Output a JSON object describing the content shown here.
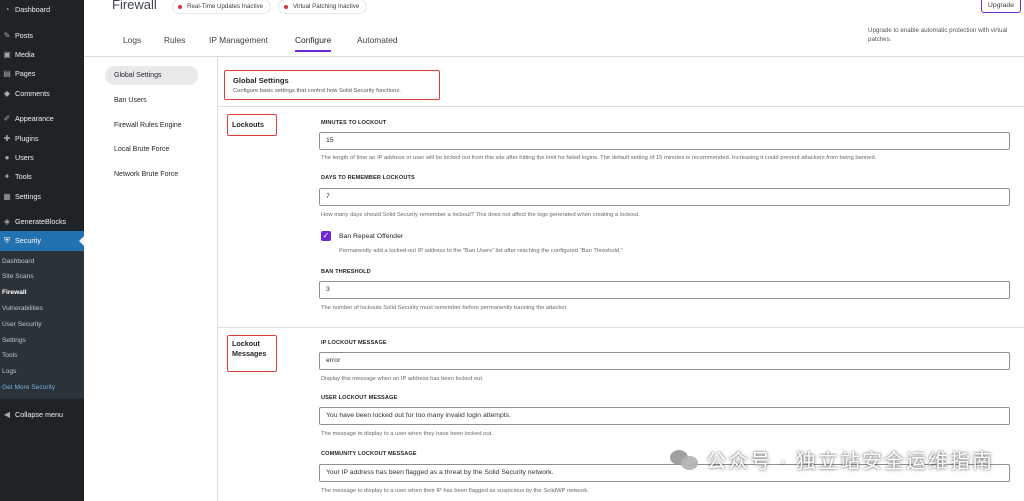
{
  "wp_menu": {
    "items_top": [
      {
        "icon": "dashboard-icon",
        "glyph": "◔",
        "label": "Dashboard"
      },
      {
        "gap": true
      },
      {
        "icon": "pin-icon",
        "glyph": "✎",
        "label": "Posts"
      },
      {
        "icon": "media-icon",
        "glyph": "▣",
        "label": "Media"
      },
      {
        "icon": "page-icon",
        "glyph": "▤",
        "label": "Pages"
      },
      {
        "icon": "comment-icon",
        "glyph": "◆",
        "label": "Comments"
      },
      {
        "gap": true
      },
      {
        "icon": "brush-icon",
        "glyph": "✐",
        "label": "Appearance"
      },
      {
        "icon": "plugin-icon",
        "glyph": "✚",
        "label": "Plugins"
      },
      {
        "icon": "users-icon",
        "glyph": "●",
        "label": "Users"
      },
      {
        "icon": "wrench-icon",
        "glyph": "✦",
        "label": "Tools"
      },
      {
        "icon": "settings-icon",
        "glyph": "▦",
        "label": "Settings"
      },
      {
        "gap": true
      },
      {
        "icon": "blocks-icon",
        "glyph": "◈",
        "label": "GenerateBlocks"
      },
      {
        "icon": "shield-icon",
        "glyph": "⛨",
        "label": "Security",
        "active": true
      }
    ],
    "submenu": [
      {
        "label": "Dashboard"
      },
      {
        "label": "Site Scans"
      },
      {
        "label": "Firewall",
        "current": true
      },
      {
        "label": "Vulnerabilities"
      },
      {
        "label": "User Security"
      },
      {
        "label": "Settings"
      },
      {
        "label": "Tools"
      },
      {
        "label": "Logs"
      },
      {
        "label": "Get More Security",
        "more": true
      }
    ],
    "collapse": {
      "icon": "collapse-icon",
      "glyph": "◀",
      "label": "Collapse menu"
    }
  },
  "header": {
    "title": "Firewall",
    "badges": [
      "Real-Time Updates Inactive",
      "Virtual Patching Inactive"
    ],
    "upgrade": "Upgrade",
    "notice": "Upgrade to enable automatic protection with virtual patches.",
    "badge_color": "#d63638",
    "accent": "#6d28d9"
  },
  "tabs": [
    "Logs",
    "Rules",
    "IP Management",
    "Configure",
    "Automated"
  ],
  "selected_tab": "Configure",
  "leftnav": [
    "Global Settings",
    "Ban Users",
    "Firewall Rules Engine",
    "Local Brute Force",
    "Network Brute Force"
  ],
  "section": {
    "title": "Global Settings",
    "subtitle": "Configure basic settings that control how Solid Security functions."
  },
  "lockouts": {
    "label": "Lockouts",
    "minutes_label": "MINUTES TO LOCKOUT",
    "minutes_value": "15",
    "minutes_help": "The length of time an IP address or user will be locked out from this site after hitting the limit for failed logins. The default setting of 15 minutes is recommended. Increasing it could prevent attackers from being banned.",
    "days_label": "DAYS TO REMEMBER LOCKOUTS",
    "days_value": "7",
    "days_help": "How many days should Solid Security remember a lockout? This does not affect the logs generated when creating a lockout.",
    "ban_repeat_label": "Ban Repeat Offender",
    "ban_repeat_checked": true,
    "ban_repeat_help": "Permanently add a locked-out IP address to the “Ban Users” list after reaching the configured “Ban Threshold.”",
    "threshold_label": "BAN THRESHOLD",
    "threshold_value": "3",
    "threshold_help": "The number of lockouts Solid Security must remember before permanently banning the attacker."
  },
  "messages": {
    "label_line1": "Lockout",
    "label_line2": "Messages",
    "ip_label": "IP LOCKOUT MESSAGE",
    "ip_value": "error",
    "ip_help": "Display this message when an IP address has been locked out.",
    "user_label": "USER LOCKOUT MESSAGE",
    "user_value": "You have been locked out for too many invalid login attempts.",
    "user_help": "The message to display to a user when they have been locked out.",
    "community_label": "COMMUNITY LOCKOUT MESSAGE",
    "community_value": "Your IP address has been flagged as a threat by the Solid Security network.",
    "community_help": "The message to display to a user when their IP has been flagged as suspicious by the SolidWP network."
  },
  "watermark": "公众号 · 独立站安全运维指南"
}
